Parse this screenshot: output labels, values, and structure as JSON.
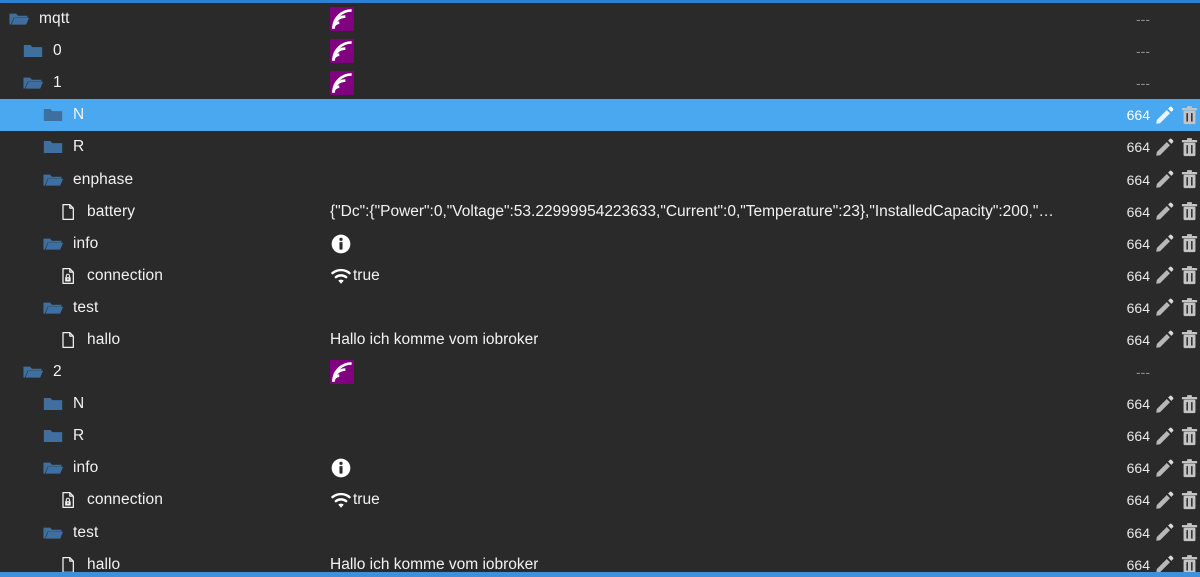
{
  "window": {
    "title": "mqtt object tree",
    "accent_color": "#4aa8f0",
    "background_color": "#2a2a2a",
    "folder_color": "#3f6f9f",
    "badge_color": "#800080",
    "top_border_color": "#2f7fd4",
    "bottom_border_color": "#3f8fdc"
  },
  "icons": {
    "folder_open": "folder-open-icon",
    "folder_closed": "folder-closed-icon",
    "file": "file-icon",
    "file_lock": "file-lock-icon",
    "rss": "rss-broadcast-icon",
    "info": "info-icon",
    "wifi": "wifi-icon",
    "edit": "pencil-edit-icon",
    "delete": "trash-delete-icon"
  },
  "tree": {
    "rows": [
      {
        "id": "mqtt",
        "name": "mqtt",
        "depth": 0,
        "icon": "folder-open-icon",
        "value": "",
        "value_icon": "rss-broadcast-icon",
        "size": "---",
        "size_dim": true,
        "selected": false,
        "has_actions": false
      },
      {
        "id": "mqtt-0",
        "name": "0",
        "depth": 1,
        "icon": "folder-closed-icon",
        "value": "",
        "value_icon": "rss-broadcast-icon",
        "size": "---",
        "size_dim": true,
        "selected": false,
        "has_actions": false
      },
      {
        "id": "mqtt-1",
        "name": "1",
        "depth": 1,
        "icon": "folder-open-icon",
        "value": "",
        "value_icon": "rss-broadcast-icon",
        "size": "---",
        "size_dim": true,
        "selected": false,
        "has_actions": false
      },
      {
        "id": "mqtt-1-N",
        "name": "N",
        "depth": 2,
        "icon": "folder-closed-icon",
        "value": "",
        "value_icon": "",
        "size": "664",
        "size_dim": false,
        "selected": true,
        "has_actions": true
      },
      {
        "id": "mqtt-1-R",
        "name": "R",
        "depth": 2,
        "icon": "folder-closed-icon",
        "value": "",
        "value_icon": "",
        "size": "664",
        "size_dim": false,
        "selected": false,
        "has_actions": true
      },
      {
        "id": "mqtt-1-enphase",
        "name": "enphase",
        "depth": 2,
        "icon": "folder-open-icon",
        "value": "",
        "value_icon": "",
        "size": "664",
        "size_dim": false,
        "selected": false,
        "has_actions": true
      },
      {
        "id": "mqtt-1-enphase-battery",
        "name": "battery",
        "depth": 3,
        "icon": "file-icon",
        "value": "{\"Dc\":{\"Power\":0,\"Voltage\":53.22999954223633,\"Current\":0,\"Temperature\":23},\"InstalledCapacity\":200,\"C...",
        "value_icon": "",
        "size": "664",
        "size_dim": false,
        "selected": false,
        "has_actions": true
      },
      {
        "id": "mqtt-1-info",
        "name": "info",
        "depth": 2,
        "icon": "folder-open-icon",
        "value": "",
        "value_icon": "info-icon",
        "size": "664",
        "size_dim": false,
        "selected": false,
        "has_actions": true
      },
      {
        "id": "mqtt-1-info-connection",
        "name": "connection",
        "depth": 3,
        "icon": "file-lock-icon",
        "value": "true",
        "value_icon": "wifi-icon",
        "size": "664",
        "size_dim": false,
        "selected": false,
        "has_actions": true
      },
      {
        "id": "mqtt-1-test",
        "name": "test",
        "depth": 2,
        "icon": "folder-open-icon",
        "value": "",
        "value_icon": "",
        "size": "664",
        "size_dim": false,
        "selected": false,
        "has_actions": true
      },
      {
        "id": "mqtt-1-test-hallo",
        "name": "hallo",
        "depth": 3,
        "icon": "file-icon",
        "value": "Hallo ich komme vom iobroker",
        "value_icon": "",
        "size": "664",
        "size_dim": false,
        "selected": false,
        "has_actions": true
      },
      {
        "id": "mqtt-2",
        "name": "2",
        "depth": 1,
        "icon": "folder-open-icon",
        "value": "",
        "value_icon": "rss-broadcast-icon",
        "size": "---",
        "size_dim": true,
        "selected": false,
        "has_actions": false
      },
      {
        "id": "mqtt-2-N",
        "name": "N",
        "depth": 2,
        "icon": "folder-closed-icon",
        "value": "",
        "value_icon": "",
        "size": "664",
        "size_dim": false,
        "selected": false,
        "has_actions": true
      },
      {
        "id": "mqtt-2-R",
        "name": "R",
        "depth": 2,
        "icon": "folder-closed-icon",
        "value": "",
        "value_icon": "",
        "size": "664",
        "size_dim": false,
        "selected": false,
        "has_actions": true
      },
      {
        "id": "mqtt-2-info",
        "name": "info",
        "depth": 2,
        "icon": "folder-open-icon",
        "value": "",
        "value_icon": "info-icon",
        "size": "664",
        "size_dim": false,
        "selected": false,
        "has_actions": true
      },
      {
        "id": "mqtt-2-info-connection",
        "name": "connection",
        "depth": 3,
        "icon": "file-lock-icon",
        "value": "true",
        "value_icon": "wifi-icon",
        "size": "664",
        "size_dim": false,
        "selected": false,
        "has_actions": true
      },
      {
        "id": "mqtt-2-test",
        "name": "test",
        "depth": 2,
        "icon": "folder-open-icon",
        "value": "",
        "value_icon": "",
        "size": "664",
        "size_dim": false,
        "selected": false,
        "has_actions": true
      },
      {
        "id": "mqtt-2-test-hallo",
        "name": "hallo",
        "depth": 3,
        "icon": "file-icon",
        "value": "Hallo ich komme vom iobroker",
        "value_icon": "",
        "size": "664",
        "size_dim": false,
        "selected": false,
        "has_actions": true
      }
    ]
  }
}
